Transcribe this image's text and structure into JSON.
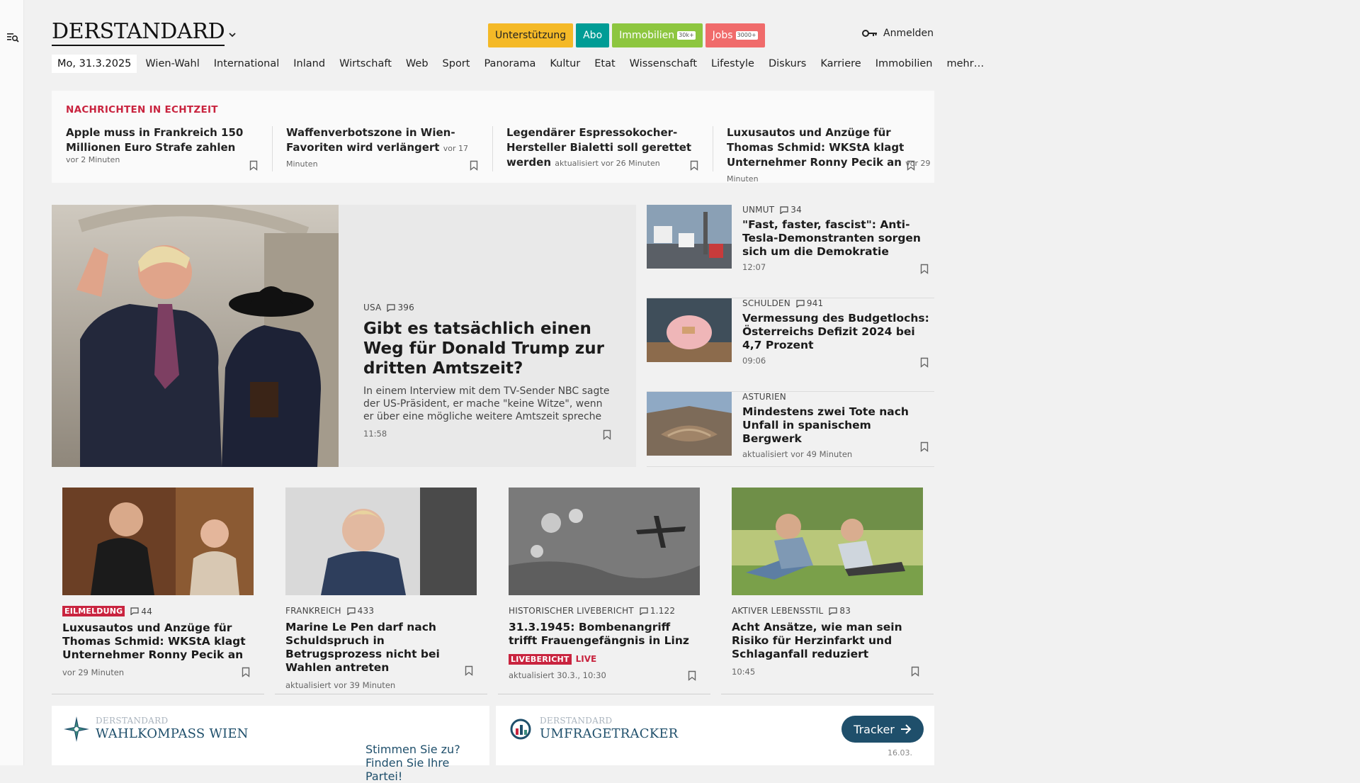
{
  "header": {
    "logo": "DERSTANDARD",
    "promos": [
      {
        "label": "Unterstützung",
        "bg": "#f4b927",
        "fg": "#222"
      },
      {
        "label": "Abo",
        "bg": "#009c95",
        "fg": "#fff"
      },
      {
        "label": "Immobilien",
        "badge": "30k+",
        "bg": "#8dc63f",
        "fg": "#fff"
      },
      {
        "label": "Jobs",
        "badge": "3000+",
        "bg": "#f06b6b",
        "fg": "#fff"
      }
    ],
    "login": "Anmelden"
  },
  "nav": {
    "date": "Mo, 31.3.2025",
    "items": [
      "Wien-Wahl",
      "International",
      "Inland",
      "Wirtschaft",
      "Web",
      "Sport",
      "Panorama",
      "Kultur",
      "Etat",
      "Wissenschaft",
      "Lifestyle",
      "Diskurs",
      "Karriere",
      "Immobilien",
      "mehr…"
    ]
  },
  "realtime": {
    "title": "NACHRICHTEN IN ECHTZEIT",
    "items": [
      {
        "headline": "Apple muss in Frankreich 150 Millionen Euro Strafe zahlen",
        "time": "vor 2 Minuten"
      },
      {
        "headline": "Waffenverbotszone in Wien-Favoriten wird verlängert",
        "time": "vor 17 Minuten"
      },
      {
        "headline": "Legendärer Espressokocher-Hersteller Bialetti soll gerettet werden",
        "time": "aktualisiert vor 26 Minuten"
      },
      {
        "headline": "Luxusautos und Anzüge für Thomas Schmid: WKStA klagt Unternehmer Ronny Pecik an",
        "time": "vor 29 Minuten"
      }
    ]
  },
  "hero": {
    "kicker": "USA",
    "comments": "396",
    "headline": "Gibt es tatsächlich einen Weg für Donald Trump zur dritten Amtszeit?",
    "teaser": "In einem Interview mit dem TV-Sender NBC sagte der US-Präsident, er mache \"keine Witze\", wenn er über eine mögliche weitere Amtszeit spreche",
    "time": "11:58"
  },
  "side": [
    {
      "kicker": "UNMUT",
      "comments": "34",
      "headline": "\"Fast, faster, fascist\": Anti-Tesla-Demonstranten sorgen sich um die Demokratie",
      "time": "12:07"
    },
    {
      "kicker": "SCHULDEN",
      "comments": "941",
      "headline": "Vermessung des Budgetlochs: Österreichs Defizit 2024 bei 4,7 Prozent",
      "time": "09:06"
    },
    {
      "kicker": "ASTURIEN",
      "comments": "",
      "headline": "Mindestens zwei Tote nach Unfall in spanischem Bergwerk",
      "time": "aktualisiert vor 49 Minuten"
    }
  ],
  "teasers": [
    {
      "flag": "EILMELDUNG",
      "kicker": "",
      "comments": "44",
      "headline": "Luxusautos und Anzüge für Thomas Schmid: WKStA klagt Unternehmer Ronny Pecik an",
      "time": "vor 29 Minuten"
    },
    {
      "flag": "",
      "kicker": "FRANKREICH",
      "comments": "433",
      "headline": "Marine Le Pen darf nach Schuldspruch in Betrugsprozess nicht bei Wahlen antreten",
      "time": "aktualisiert vor 39 Minuten"
    },
    {
      "flag": "",
      "kicker": "HISTORISCHER LIVEBERICHT",
      "comments": "1.122",
      "headline": "31.3.1945: Bombenangriff trifft Frauengefängnis in Linz",
      "liveflag": "LIVEBERICHT",
      "live": "LIVE",
      "time": "aktualisiert 30.3., 10:30"
    },
    {
      "flag": "",
      "kicker": "AKTIVER LEBENSSTIL",
      "comments": "83",
      "headline": "Acht Ansätze, wie man sein Risiko für Herzinfarkt und Schlaganfall reduziert",
      "time": "10:45"
    }
  ],
  "cards": {
    "wahlkompass": {
      "brand": "DERSTANDARD",
      "name": "WAHLKOMPASS WIEN",
      "cta": "Stimmen Sie zu? Finden Sie Ihre Partei!"
    },
    "umfrage": {
      "brand": "DERSTANDARD",
      "name": "UMFRAGETRACKER",
      "button": "Tracker",
      "date": "16.03."
    }
  },
  "colors": {
    "accent_red": "#c9243f",
    "dark_blue": "#1f4f6b"
  }
}
